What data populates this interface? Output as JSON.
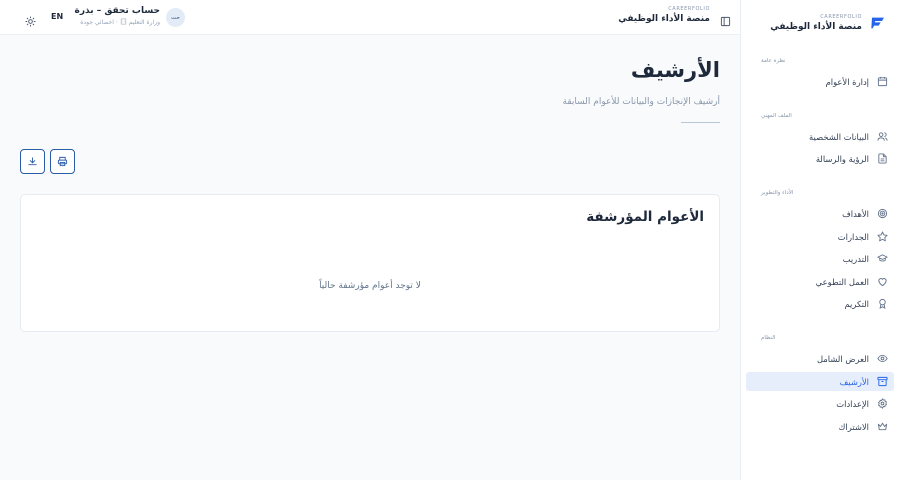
{
  "brand": {
    "subtitle": "CAREERFOLIO",
    "title": "منصة الأداء الوظيفي"
  },
  "header": {
    "brand_subtitle": "CAREERFOLIO",
    "brand_title": "منصة الأداء الوظيفي",
    "lang_label": "EN",
    "user": {
      "initials": "حت",
      "name": "حساب تحقق – بذرة",
      "role": "اخصائي جودة",
      "org": "وزارة التعليم"
    }
  },
  "sidebar": {
    "sections": [
      {
        "label": "نظرة عامة"
      },
      {
        "label": "الملف المهني"
      },
      {
        "label": "الأداء والتطوير"
      },
      {
        "label": "النظام"
      }
    ],
    "items": [
      {
        "label": "إدارة الأعوام",
        "icon": "calendar-icon"
      },
      {
        "label": "البيانات الشخصية",
        "icon": "users-icon"
      },
      {
        "label": "الرؤية والرسالة",
        "icon": "file-text-icon"
      },
      {
        "label": "الأهداف",
        "icon": "target-icon"
      },
      {
        "label": "الجدارات",
        "icon": "star-icon"
      },
      {
        "label": "التدريب",
        "icon": "graduation-cap-icon"
      },
      {
        "label": "العمل التطوعي",
        "icon": "heart-icon"
      },
      {
        "label": "التكريم",
        "icon": "award-icon"
      },
      {
        "label": "العرض الشامل",
        "icon": "eye-icon"
      },
      {
        "label": "الأرشيف",
        "icon": "archive-icon",
        "active": true
      },
      {
        "label": "الإعدادات",
        "icon": "settings-icon"
      },
      {
        "label": "الاشتراك",
        "icon": "crown-icon"
      }
    ]
  },
  "main": {
    "title": "الأرشيف",
    "subtitle": "أرشيف الإنجازات والبيانات للأعوام السابقة",
    "card": {
      "title": "الأعوام المؤرشفة",
      "empty_text": "لا توجد أعوام مؤرشفة حالياً"
    }
  },
  "colors": {
    "accent": "#2563eb",
    "active_bg": "#e7eefb",
    "button_border": "#2a5caa"
  }
}
